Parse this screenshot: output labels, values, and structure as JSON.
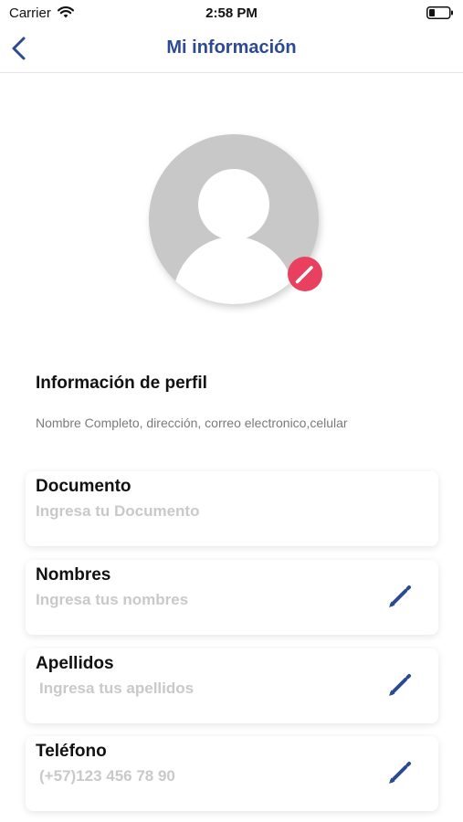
{
  "status_bar": {
    "carrier": "Carrier",
    "time": "2:58 PM",
    "icons": [
      "wifi-icon",
      "battery-icon"
    ]
  },
  "nav": {
    "title": "Mi información",
    "back_icon": "chevron-left-icon"
  },
  "avatar": {
    "icon": "user-silhouette-icon",
    "edit_icon": "pencil-icon"
  },
  "profile": {
    "title": "Información de perfil",
    "description": "Nombre Completo, dirección, correo electronico,celular"
  },
  "fields": [
    {
      "label": "Documento",
      "placeholder": "Ingresa tu Documento",
      "value": "",
      "editable_icon": false
    },
    {
      "label": "Nombres",
      "placeholder": "Ingresa tus nombres",
      "value": "",
      "editable_icon": "pencil-icon"
    },
    {
      "label": "Apellidos",
      "placeholder": "Ingresa tus apellidos",
      "value": "",
      "editable_icon": "pencil-icon"
    },
    {
      "label": "Teléfono",
      "placeholder": "(+57)123 456 78 90",
      "value": "",
      "editable_icon": "pencil-icon"
    }
  ],
  "colors": {
    "accent": "#2c4a92",
    "edit_badge": "#e8405e",
    "avatar_bg": "#c8c8c8",
    "placeholder": "#c9c9c9"
  }
}
